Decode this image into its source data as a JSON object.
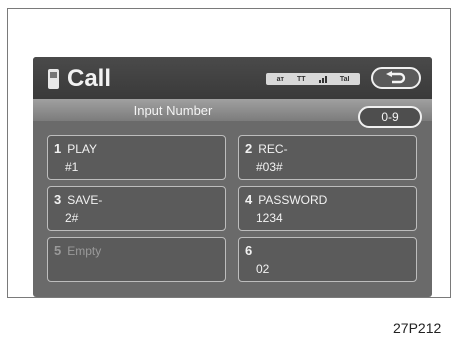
{
  "header": {
    "title": "Call",
    "status": {
      "left": "ат",
      "mid": "ТТ",
      "right": "TaI"
    }
  },
  "subheader": {
    "label": "Input Number",
    "range_button": "0-9"
  },
  "entries": [
    {
      "num": "1",
      "name": "PLAY",
      "value": "#1"
    },
    {
      "num": "2",
      "name": "REC-",
      "value": "#03#"
    },
    {
      "num": "3",
      "name": "SAVE-",
      "value": "2#"
    },
    {
      "num": "4",
      "name": "PASSWORD",
      "value": "1234"
    },
    {
      "num": "5",
      "name": "Empty",
      "value": ""
    },
    {
      "num": "6",
      "name": "",
      "value": "02"
    }
  ],
  "figure_ref": "27P212",
  "colors": {
    "screen_bg": "#6a6a6a",
    "cell_bg": "#5b5b5b",
    "text": "#f2f2f2"
  }
}
